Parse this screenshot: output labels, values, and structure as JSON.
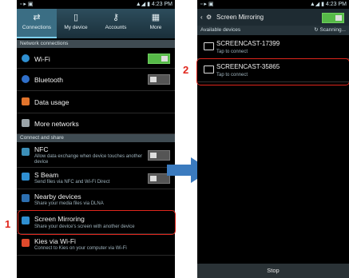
{
  "left": {
    "status_time": "4:23 PM",
    "tabs": [
      {
        "label": "Connections",
        "icon": "connections-icon"
      },
      {
        "label": "My device",
        "icon": "device-icon"
      },
      {
        "label": "Accounts",
        "icon": "key-icon"
      },
      {
        "label": "More",
        "icon": "more-icon"
      }
    ],
    "section_network": "Network connections",
    "wifi": "Wi-Fi",
    "bluetooth": "Bluetooth",
    "data_usage": "Data usage",
    "more_networks": "More networks",
    "section_connect": "Connect and share",
    "nfc_title": "NFC",
    "nfc_sub": "Allow data exchange when device touches another device",
    "sbeam_title": "S Beam",
    "sbeam_sub": "Send files via NFC and Wi-Fi Direct",
    "nearby_title": "Nearby devices",
    "nearby_sub": "Share your media files via DLNA",
    "mirroring_title": "Screen Mirroring",
    "mirroring_sub": "Share your device's screen with another device",
    "kies_title": "Kies via Wi-Fi",
    "kies_sub": "Connect to Kies on your computer via Wi-Fi"
  },
  "right": {
    "status_time": "4:23 PM",
    "title": "Screen Mirroring",
    "available": "Available devices",
    "scanning": "Scanning...",
    "devices": [
      {
        "name": "SCREENCAST-17399",
        "tap": "Tap to connect"
      },
      {
        "name": "SCREENCAST-35865",
        "tap": "Tap to connect"
      }
    ],
    "stop": "Stop"
  },
  "steps": {
    "one": "1",
    "two": "2"
  },
  "colors": {
    "accent_red": "#e0261c",
    "arrow": "#3b7bbf",
    "switch_on": "#56b948"
  }
}
